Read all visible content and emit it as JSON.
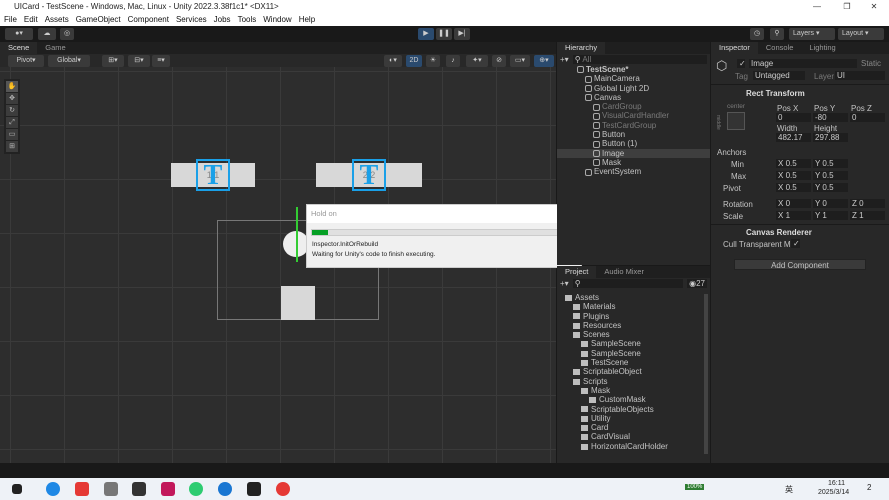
{
  "window": {
    "title": "UICard - TestScene - Windows, Mac, Linux - Unity 2022.3.38f1c1* <DX11>",
    "minimize": "—",
    "maximize": "❐",
    "close": "✕"
  },
  "menu": [
    "File",
    "Edit",
    "Assets",
    "GameObject",
    "Component",
    "Services",
    "Jobs",
    "Tools",
    "Window",
    "Help"
  ],
  "toolbar": {
    "play": "▶",
    "pause": "❚❚",
    "step": "▶|",
    "layers": "Layers",
    "layout": "Layout"
  },
  "scene": {
    "tabs": [
      "Scene",
      "Game"
    ],
    "pivot": "Pivot",
    "global": "Global",
    "mode2d": "2D",
    "cards": [
      {
        "label": "1 1",
        "icon": "T"
      },
      {
        "label": "2 2",
        "icon": "T"
      }
    ]
  },
  "dialog": {
    "title": "Hold on",
    "progress": 0.06,
    "task": "Inspector.InitOrRebuild",
    "message": "Waiting for Unity's code to finish executing."
  },
  "hierarchy": {
    "tab": "Hierarchy",
    "search_placeholder": "All",
    "items": [
      {
        "label": "TestScene*",
        "depth": 0,
        "bold": true
      },
      {
        "label": "MainCamera",
        "depth": 1
      },
      {
        "label": "Global Light 2D",
        "depth": 1
      },
      {
        "label": "Canvas",
        "depth": 1,
        "expanded": true
      },
      {
        "label": "CardGroup",
        "depth": 2,
        "dim": true
      },
      {
        "label": "VisualCardHandler",
        "depth": 2,
        "dim": true
      },
      {
        "label": "TestCardGroup",
        "depth": 2,
        "dim": true
      },
      {
        "label": "Button",
        "depth": 2
      },
      {
        "label": "Button (1)",
        "depth": 2
      },
      {
        "label": "Image",
        "depth": 2,
        "selected": true
      },
      {
        "label": "Mask",
        "depth": 2
      },
      {
        "label": "EventSystem",
        "depth": 1
      }
    ]
  },
  "project": {
    "tabs": [
      "Project",
      "Audio Mixer"
    ],
    "count": "27",
    "items": [
      {
        "label": "Assets",
        "depth": 0
      },
      {
        "label": "Materials",
        "depth": 1
      },
      {
        "label": "Plugins",
        "depth": 1
      },
      {
        "label": "Resources",
        "depth": 1
      },
      {
        "label": "Scenes",
        "depth": 1
      },
      {
        "label": "SampleScene",
        "depth": 2
      },
      {
        "label": "SampleScene",
        "depth": 2
      },
      {
        "label": "TestScene",
        "depth": 2
      },
      {
        "label": "ScriptableObject",
        "depth": 1
      },
      {
        "label": "Scripts",
        "depth": 1
      },
      {
        "label": "Mask",
        "depth": 2
      },
      {
        "label": "CustomMask",
        "depth": 3
      },
      {
        "label": "ScriptableObjects",
        "depth": 2
      },
      {
        "label": "Utility",
        "depth": 2
      },
      {
        "label": "Card",
        "depth": 2
      },
      {
        "label": "CardVisual",
        "depth": 2
      },
      {
        "label": "HorizontalCardHolder",
        "depth": 2
      }
    ]
  },
  "inspector": {
    "tabs": [
      "Inspector",
      "Console",
      "Lighting"
    ],
    "name": "Image",
    "static": "Static",
    "tag_label": "Tag",
    "tag": "Untagged",
    "layer_label": "Layer",
    "layer": "UI",
    "rect": {
      "title": "Rect Transform",
      "anchor_preset": "center",
      "side": "middle",
      "posx_label": "Pos X",
      "posy_label": "Pos Y",
      "posz_label": "Pos Z",
      "posx": "0",
      "posy": "-80",
      "posz": "0",
      "w_label": "Width",
      "h_label": "Height",
      "width": "482.17",
      "height": "297.88",
      "anchors": "Anchors",
      "min": "Min",
      "max": "Max",
      "pivot": "Pivot",
      "rotation": "Rotation",
      "scale": "Scale",
      "minx": "0.5",
      "miny": "0.5",
      "maxx": "0.5",
      "maxy": "0.5",
      "pivx": "0.5",
      "pivy": "0.5",
      "rotx": "0",
      "roty": "0",
      "rotz": "0",
      "sx": "1",
      "sy": "1",
      "sz": "1"
    },
    "canvas_renderer": {
      "title": "Canvas Renderer",
      "cull": "Cull Transparent Me"
    },
    "add_component": "Add Component"
  },
  "taskbar": {
    "battery": "100%",
    "ime": "英",
    "time": "16:11",
    "date": "2025/3/14",
    "notifications": "2"
  }
}
